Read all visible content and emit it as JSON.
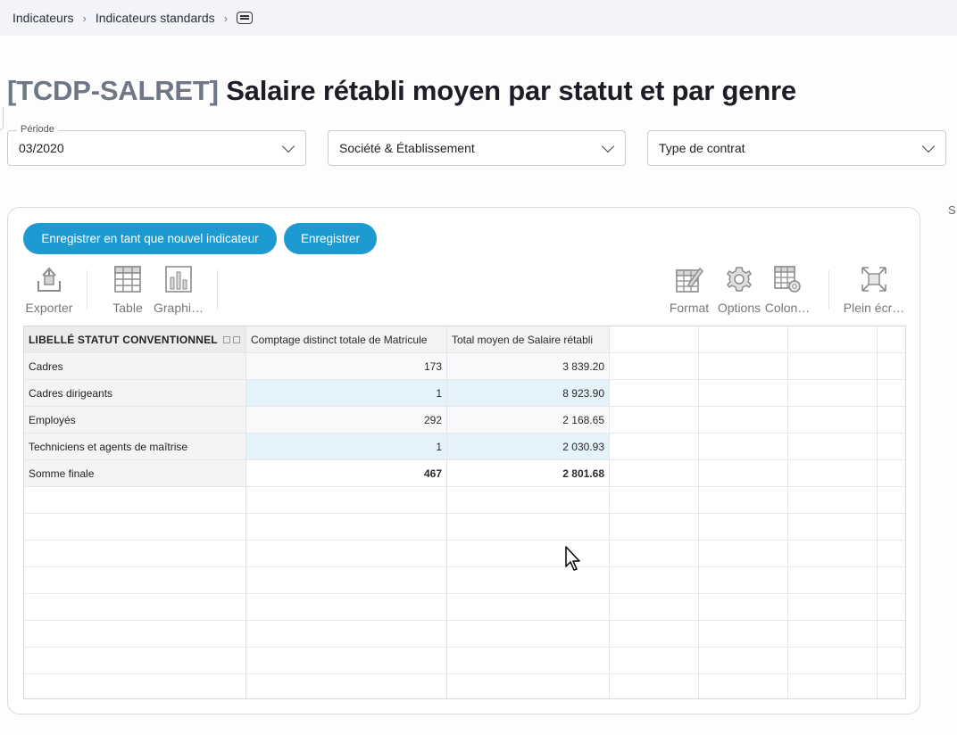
{
  "breadcrumb": {
    "items": [
      "Indicateurs",
      "Indicateurs standards"
    ],
    "separator": "›",
    "end_icon": "keyboard-icon"
  },
  "title": {
    "code": "[TCDP-SALRET]",
    "name": "Salaire rétabli moyen par statut et par genre"
  },
  "filters": [
    {
      "label": "Période",
      "value": "03/2020"
    },
    {
      "label": "",
      "value": "Société & Établissement"
    },
    {
      "label": "",
      "value": "Type de contrat"
    }
  ],
  "edge_letter": "S",
  "actions": {
    "save_new": "Enregistrer en tant que nouvel indicateur",
    "save": "Enregistrer"
  },
  "toolbar": {
    "export": "Exporter",
    "table": "Table",
    "chart": "Graphi…",
    "format": "Format",
    "options": "Options",
    "columns": "Colon…",
    "fullscreen": "Plein écr…"
  },
  "grid": {
    "columns": [
      "LIBELLÉ STATUT CONVENTIONNEL",
      "Comptage distinct totale de  Matricule",
      "Total moyen de Salaire rétabli"
    ],
    "rows": [
      [
        "Cadres",
        "173",
        "3 839.20"
      ],
      [
        "Cadres dirigeants",
        "1",
        "8 923.90"
      ],
      [
        "Employés",
        "292",
        "2 168.65"
      ],
      [
        "Techniciens et agents de maîtrise",
        "1",
        "2 030.93"
      ],
      [
        "Somme finale",
        "467",
        "2 801.68"
      ]
    ]
  },
  "colors": {
    "accent": "#1d9bd1",
    "row_highlight": "#e4f2fa",
    "title_code": "#6f7687"
  }
}
